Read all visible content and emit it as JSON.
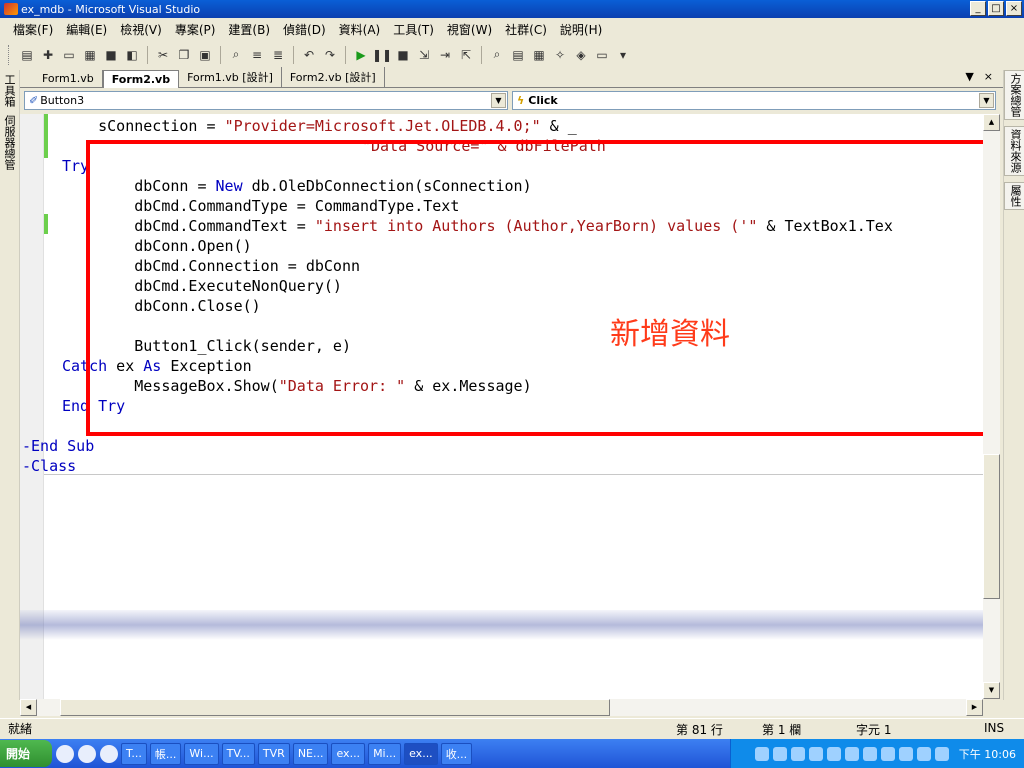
{
  "window": {
    "title": "ex_mdb - Microsoft Visual Studio",
    "min": "_",
    "max": "□",
    "close": "×"
  },
  "menu": [
    "檔案(F)",
    "編輯(E)",
    "檢視(V)",
    "專案(P)",
    "建置(B)",
    "偵錯(D)",
    "資料(A)",
    "工具(T)",
    "視窗(W)",
    "社群(C)",
    "說明(H)"
  ],
  "left_dock": [
    "工具箱",
    "伺服器總管"
  ],
  "right_dock": [
    "方案總管",
    "資料來源",
    "屬性"
  ],
  "tabs": [
    "Form1.vb",
    "Form2.vb",
    "Form1.vb [設計]",
    "Form2.vb [設計]"
  ],
  "active_tab": "Form2.vb",
  "doc_tools": {
    "dropdown": "▼",
    "close": "×"
  },
  "selectors": {
    "object": "Button3",
    "event": "Click"
  },
  "code": {
    "l1a": "    sConnection = ",
    "l1s": "\"Provider=Microsoft.Jet.OLEDB.4.0;\"",
    "l1b": " & _",
    "l2s": "\"Data Source=\"",
    "l2b": " & dbFilePath",
    "l3": "Try",
    "l4a": "        dbConn = ",
    "l4k": "New",
    "l4b": " db.OleDbConnection(sConnection)",
    "l5": "        dbCmd.CommandType = CommandType.Text",
    "l6a": "        dbCmd.CommandText = ",
    "l6s": "\"insert into Authors (Author,YearBorn) values ('\"",
    "l6b": " & TextBox1.Tex",
    "l7": "        dbConn.Open()",
    "l8": "        dbCmd.Connection = dbConn",
    "l9": "        dbCmd.ExecuteNonQuery()",
    "l10": "        dbConn.Close()",
    "l12": "        Button1_Click(sender, e)",
    "l13k": "Catch",
    "l13a": " ex ",
    "l13k2": "As",
    "l13b": " Exception",
    "l14a": "        MessageBox.Show(",
    "l14s": "\"Data Error: \"",
    "l14b": " & ex.Message)",
    "l15k": "End Try",
    "l17k": "-End Sub",
    "l18k": "-Class"
  },
  "annotation": "新增資料",
  "status": {
    "ready": "就緒",
    "line": "第 81 行",
    "col": "第 1 欄",
    "char": "字元 1",
    "mode": "INS"
  },
  "taskbar": {
    "start": "開始",
    "tasks": [
      "T...",
      "帳...",
      "Wi...",
      "TV...",
      "TVR",
      "NE...",
      "ex...",
      "Mi...",
      "ex...",
      "收..."
    ],
    "clock": "下午 10:06"
  }
}
